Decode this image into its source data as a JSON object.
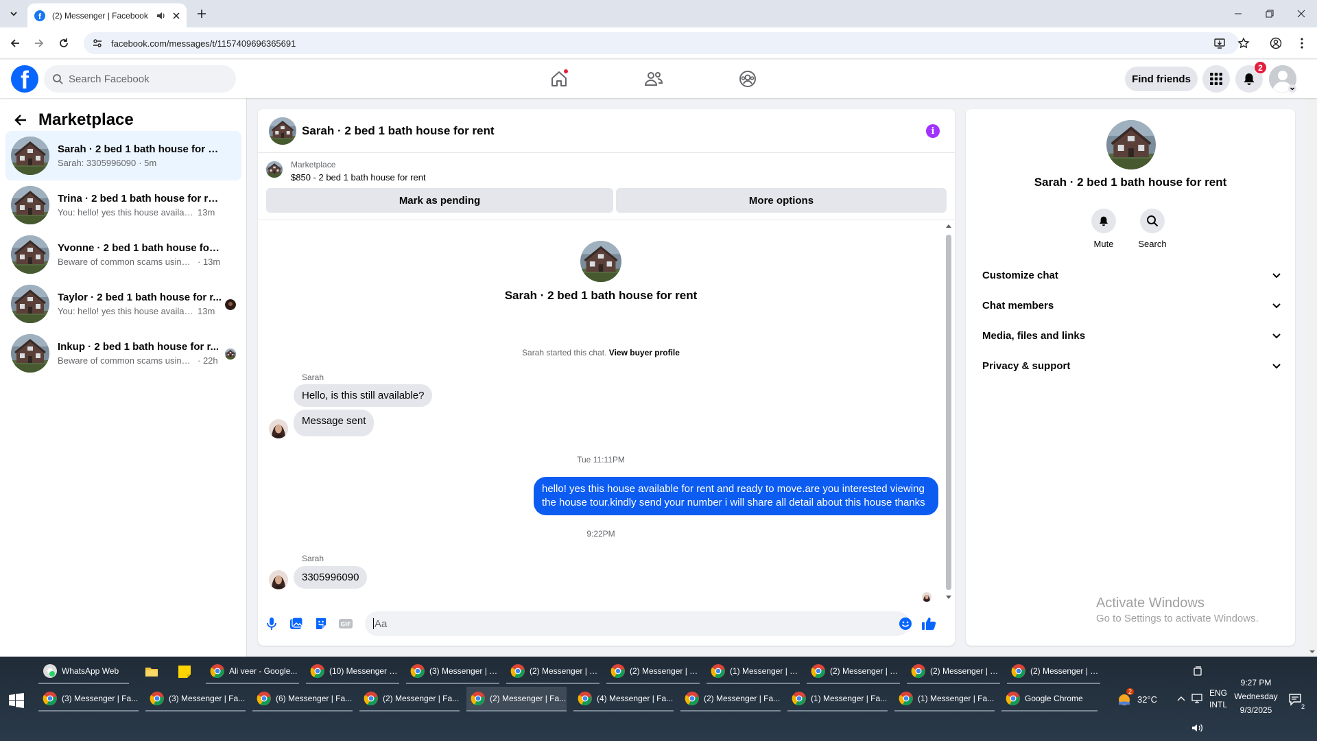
{
  "browser": {
    "tab_title": "(2) Messenger | Facebook",
    "url": "facebook.com/messages/t/1157409696365691"
  },
  "header": {
    "search_placeholder": "Search Facebook",
    "find_friends": "Find friends",
    "notification_count": "2",
    "brand_color": "#0866ff"
  },
  "sidebar": {
    "title": "Marketplace",
    "conversations": [
      {
        "name": "Sarah · 2 bed 1 bath house for rent",
        "snippet": "Sarah: 3305996090",
        "time": "· 5m"
      },
      {
        "name": "Trina · 2 bed 1 bath house for rent",
        "snippet": "You: hello! yes this house available f...",
        "time": "13m"
      },
      {
        "name": "Yvonne · 2 bed 1 bath house for rent",
        "snippet": "Beware of common scams using pa...",
        "time": "· 13m"
      },
      {
        "name": "Taylor · 2 bed 1 bath house for r...",
        "snippet": "You: hello! yes this house availabl...",
        "time": "13m"
      },
      {
        "name": "Inkup · 2 bed 1 bath house for r...",
        "snippet": "Beware of common scams using ...",
        "time": "· 22h"
      }
    ]
  },
  "chat": {
    "title": "Sarah · 2 bed 1 bath house for rent",
    "listing_source": "Marketplace",
    "listing_title": "$850 - 2 bed 1 bath house for rent",
    "mark_pending": "Mark as pending",
    "more_options": "More options",
    "intro_name": "Sarah · 2 bed 1 bath house for rent",
    "started_text": "Sarah started this chat.",
    "view_profile": "View buyer profile",
    "sender1": "Sarah",
    "msg1": "Hello, is this still available?",
    "msg2": "Message sent",
    "stamp1": "Tue 11:11PM",
    "out_msg": "hello! yes this house available for rent and ready to move.are you interested viewing the house tour.kindly send your number i will share all detail about this house thanks",
    "stamp2": "9:22PM",
    "sender2": "Sarah",
    "msg3": "3305996090",
    "composer_placeholder": "Aa",
    "accent_color": "#0c5cf2"
  },
  "info_panel": {
    "name": "Sarah · 2 bed 1 bath house for rent",
    "mute": "Mute",
    "search": "Search",
    "sections": [
      "Customize chat",
      "Chat members",
      "Media, files and links",
      "Privacy & support"
    ]
  },
  "watermark": {
    "line1": "Activate Windows",
    "line2": "Go to Settings to activate Windows."
  },
  "taskbar": {
    "row1": [
      "WhatsApp Web",
      "",
      "",
      "Ali veer - Google...",
      "(10) Messenger | ...",
      "(3) Messenger | F...",
      "(2) Messenger | F...",
      "(2) Messenger | F...",
      "(1) Messenger | F...",
      "(2) Messenger | F...",
      "(2) Messenger | F...",
      "(2) Messenger | F..."
    ],
    "row2": [
      "(3) Messenger | Fa...",
      "(3) Messenger | Fa...",
      "(6) Messenger | Fa...",
      "(2) Messenger | Fa...",
      "(2) Messenger | Fa...",
      "(4) Messenger | Fa...",
      "(2) Messenger | Fa...",
      "(1) Messenger | Fa...",
      "(1) Messenger | Fa...",
      "Google Chrome"
    ],
    "weather_temp": "32°C",
    "weather_badge": "2",
    "lang1": "ENG",
    "lang2": "INTL",
    "time": "9:27 PM",
    "day": "Wednesday",
    "date": "9/3/2025",
    "notif_badge": "2"
  }
}
